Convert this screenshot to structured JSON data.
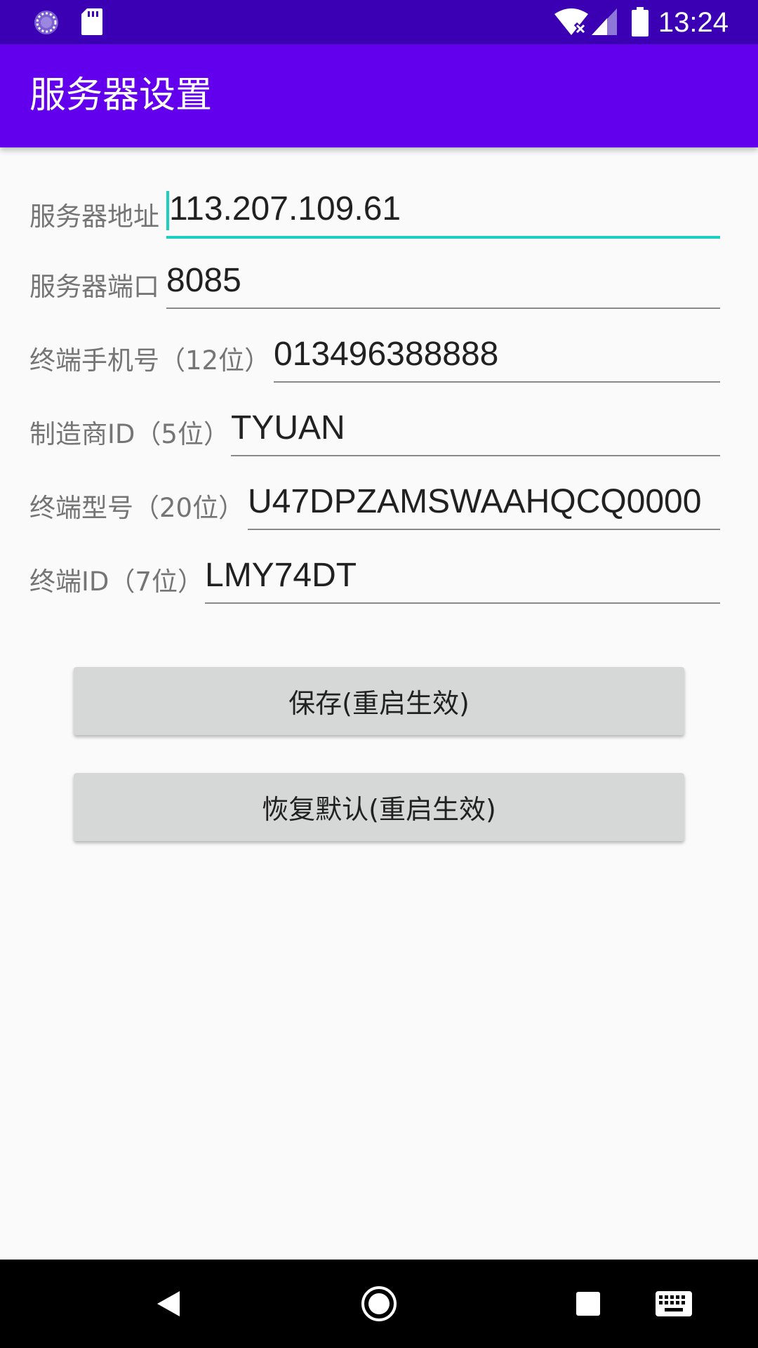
{
  "status_bar": {
    "time": "13:24",
    "icons": [
      "sync-icon",
      "sd-card-icon",
      "wifi-off-icon",
      "signal-icon",
      "battery-icon"
    ]
  },
  "app_bar": {
    "title": "服务器设置"
  },
  "form": {
    "fields": [
      {
        "label": "服务器地址",
        "value": "113.207.109.61"
      },
      {
        "label": "服务器端口",
        "value": "8085"
      },
      {
        "label": "终端手机号（12位）",
        "value": "013496388888"
      },
      {
        "label": "制造商ID（5位）",
        "value": "TYUAN"
      },
      {
        "label": "终端型号（20位）",
        "value": "U47DPZAMSWAAHQCQ0000"
      },
      {
        "label": "终端ID（7位）",
        "value": "LMY74DT"
      }
    ]
  },
  "buttons": {
    "save_label": "保存(重启生效)",
    "reset_label": "恢复默认(重启生效)"
  },
  "nav_bar": {
    "icons": [
      "back-icon",
      "home-icon",
      "recents-icon",
      "keyboard-icon"
    ]
  },
  "colors": {
    "status_bar": "#3b00b3",
    "app_bar": "#6200ee",
    "focus_accent": "#1ccfc0",
    "button_bg": "#d6d7d7"
  }
}
